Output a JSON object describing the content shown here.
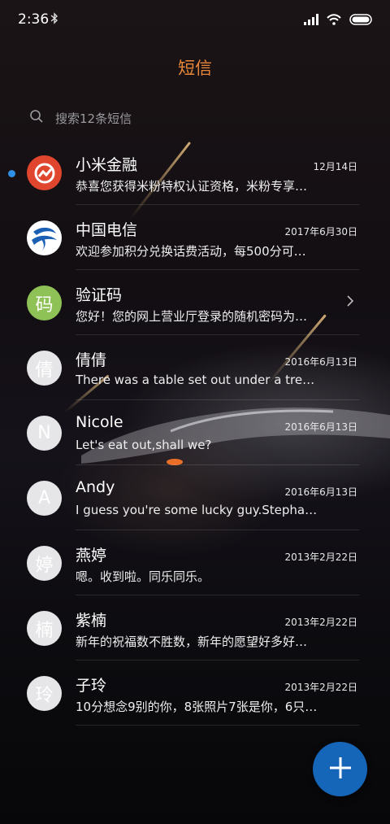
{
  "status_bar": {
    "time": "2:36"
  },
  "header": {
    "title": "短信"
  },
  "search": {
    "placeholder": "搜索12条短信"
  },
  "conversations": [
    {
      "name": "小米金融",
      "date": "12月14日",
      "preview": "恭喜您获得米粉特权认证资格，米粉专享…",
      "avatar_icon": "xiaomi-finance-logo",
      "unread": true
    },
    {
      "name": "中国电信",
      "date": "2017年6月30日",
      "preview": "欢迎参加积分兑换话费活动，每500分可…",
      "avatar_icon": "china-telecom-logo",
      "unread": false
    },
    {
      "name": "验证码",
      "date": "",
      "preview": "您好！您的网上营业厅登录的随机密码为…",
      "avatar_text": "码",
      "unread": false
    },
    {
      "name": "倩倩",
      "date": "2016年6月13日",
      "preview": "There was a table set out under a tree i…",
      "avatar_text": "倩",
      "unread": false
    },
    {
      "name": "Nicole",
      "date": "2016年6月13日",
      "preview": "Let's eat out,shall we?",
      "avatar_text": "N",
      "unread": false
    },
    {
      "name": "Andy",
      "date": "2016年6月13日",
      "preview": "I guess you're some lucky guy.Stepha…",
      "avatar_text": "A",
      "unread": false
    },
    {
      "name": "燕婷",
      "date": "2013年2月22日",
      "preview": "嗯。收到啦。同乐同乐。",
      "avatar_text": "婷",
      "unread": false
    },
    {
      "name": "紫楠",
      "date": "2013年2月22日",
      "preview": "新年的祝福数不胜数，新年的愿望好多好…",
      "avatar_text": "楠",
      "unread": false
    },
    {
      "name": "子玲",
      "date": "2013年2月22日",
      "preview": "10分想念9别的你，8张照片7张是你，6只…",
      "avatar_text": "玲",
      "unread": false
    }
  ],
  "colors": {
    "title": "#e8873a",
    "unread_dot": "#2f8fe6",
    "fab": "#1565b8"
  },
  "fab": {
    "icon": "plus-icon"
  }
}
